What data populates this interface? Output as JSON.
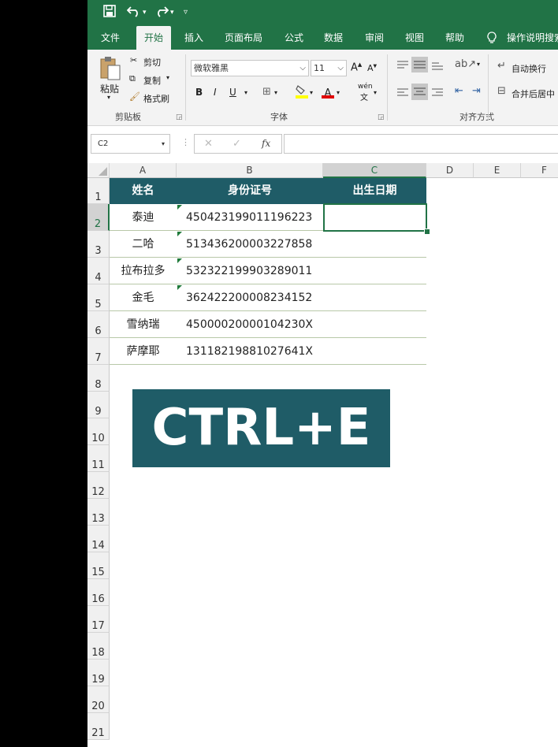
{
  "ribbon_tabs": [
    "文件",
    "开始",
    "插入",
    "页面布局",
    "公式",
    "数据",
    "审阅",
    "视图",
    "帮助"
  ],
  "tell_me": "操作说明搜索",
  "clipboard": {
    "paste": "粘贴",
    "cut": "剪切",
    "copy": "复制",
    "format_painter": "格式刷",
    "group": "剪贴板"
  },
  "font": {
    "name": "微软雅黑",
    "size": "11",
    "bold": "B",
    "italic": "I",
    "underline": "U",
    "grow": "A",
    "shrink": "A",
    "color_letter": "A",
    "phonetic": "wén",
    "group": "字体"
  },
  "alignment": {
    "wrap": "自动换行",
    "merge": "合并后居中",
    "group": "对齐方式"
  },
  "name_box": "C2",
  "fx": "fx",
  "columns": [
    "A",
    "B",
    "C",
    "D",
    "E",
    "F"
  ],
  "rows": [
    "1",
    "2",
    "3",
    "4",
    "5",
    "6",
    "7",
    "8",
    "9",
    "10",
    "11",
    "12",
    "13",
    "14",
    "15",
    "16",
    "17",
    "18",
    "19",
    "20",
    "21"
  ],
  "table": {
    "headers": [
      "姓名",
      "身份证号",
      "出生日期"
    ],
    "rows": [
      {
        "name": "泰迪",
        "id": "450423199011196223"
      },
      {
        "name": "二哈",
        "id": "513436200003227858"
      },
      {
        "name": "拉布拉多",
        "id": "532322199903289011"
      },
      {
        "name": "金毛",
        "id": "362422200008234152"
      },
      {
        "name": "雪纳瑞",
        "id": "45000020000104230X"
      },
      {
        "name": "萨摩耶",
        "id": "13118219881027641X"
      }
    ]
  },
  "banner": "CTRL+E",
  "colors": {
    "excel_green": "#217346",
    "header_fill": "#1f5c67"
  }
}
